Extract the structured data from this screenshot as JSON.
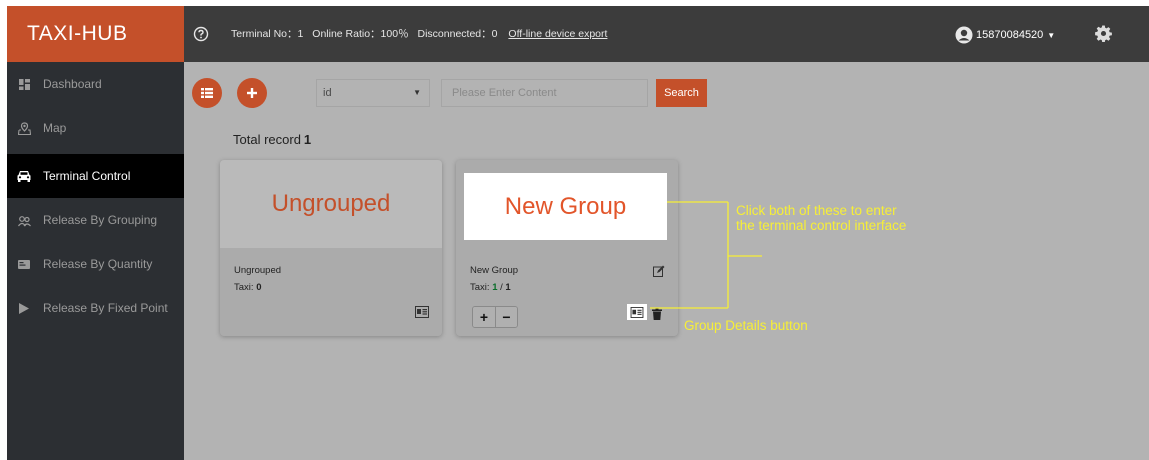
{
  "header": {
    "brand": "TAXI-HUB",
    "terminal_no": "Terminal No：1",
    "online_ratio": "Online Ratio：100％",
    "disconnected": "Disconnected：0",
    "export_link": "Off-line device export",
    "user": "15870084520"
  },
  "sidebar": {
    "items": [
      {
        "label": "Dashboard",
        "icon": "dashboard-icon",
        "active": false
      },
      {
        "label": "Map",
        "icon": "map-icon",
        "active": false
      },
      {
        "label": "Terminal Control",
        "icon": "car-icon",
        "active": true
      },
      {
        "label": "Release By Grouping",
        "icon": "group-icon",
        "active": false
      },
      {
        "label": "Release By Quantity",
        "icon": "card-icon",
        "active": false
      },
      {
        "label": "Release By Fixed Point",
        "icon": "play-icon",
        "active": false
      }
    ]
  },
  "toolbar": {
    "select_value": "id",
    "search_placeholder": "Please Enter Content",
    "search_button": "Search"
  },
  "total": {
    "label": "Total record",
    "count": "1"
  },
  "cards": [
    {
      "title": "Ungrouped",
      "name": "Ungrouped",
      "taxi_label": "Taxi:",
      "taxi_count": "0"
    },
    {
      "title": "New Group",
      "name": "New Group",
      "taxi_label": "Taxi:",
      "taxi_online": "1",
      "taxi_sep": " / ",
      "taxi_total": "1"
    }
  ],
  "annotations": {
    "line1": "Click both of these to enter",
    "line2": "the terminal control interface",
    "detail": "Group Details button"
  },
  "colors": {
    "accent": "#c4502a",
    "sidebar": "#2c2f33",
    "header": "#3c3c3c",
    "annotation": "#f7ef36"
  }
}
